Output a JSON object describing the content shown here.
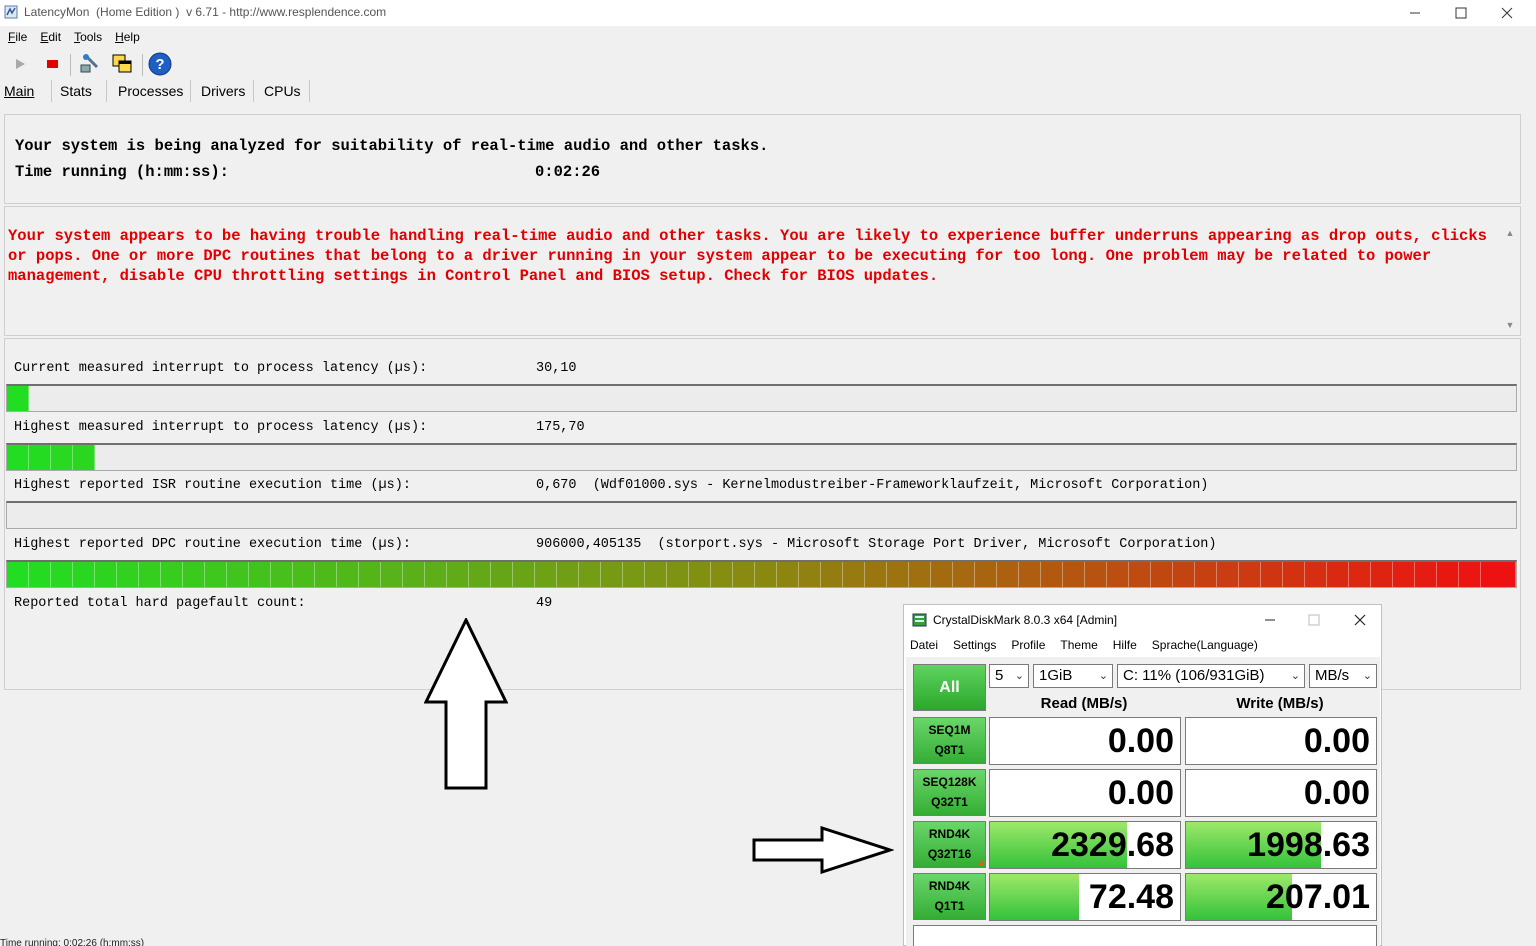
{
  "latencymon": {
    "title": "LatencyMon  (Home Edition )  v 6.71 - http://www.resplendence.com",
    "menu": [
      "File",
      "Edit",
      "Tools",
      "Help"
    ],
    "tabs": [
      "Main",
      "Stats",
      "Processes",
      "Drivers",
      "CPUs"
    ],
    "status_line1": "Your system is being analyzed for suitability of real-time audio and other tasks.",
    "status_line2_label": "Time running (h:mm:ss):",
    "status_line2_value": "0:02:26",
    "warning": "Your system appears to be having trouble handling real-time audio and other tasks. You are likely to experience buffer underruns appearing as drop outs, clicks or pops. One or more DPC routines that belong to a driver running in your system appear to be executing for too long. One problem may be related to power management, disable CPU throttling settings in Control Panel and BIOS setup. Check for BIOS updates.",
    "metrics": [
      {
        "label": "Current measured interrupt to process latency (µs):",
        "value": "30,10",
        "bar_fraction": 0.013
      },
      {
        "label": "Highest measured interrupt to process latency (µs):",
        "value": "175,70",
        "bar_fraction": 0.055
      },
      {
        "label": "Highest reported ISR routine execution time (µs):",
        "value": "0,670  (Wdf01000.sys - Kernelmodustreiber-Frameworklaufzeit, Microsoft Corporation)",
        "bar_fraction": 0.0
      },
      {
        "label": "Highest reported DPC routine execution time (µs):",
        "value": "906000,405135  (storport.sys - Microsoft Storage Port Driver, Microsoft Corporation)",
        "bar_fraction": 1.0
      },
      {
        "label": "Reported total hard pagefault count:",
        "value": "49"
      }
    ],
    "status_bar": "Time running: 0:02:26  (h:mm:ss)"
  },
  "crystaldiskmark": {
    "title": "CrystalDiskMark 8.0.3 x64 [Admin]",
    "menu": [
      "Datei",
      "Settings",
      "Profile",
      "Theme",
      "Hilfe",
      "Sprache(Language)"
    ],
    "all_label": "All",
    "count": "5",
    "size": "1GiB",
    "drive": "C: 11% (106/931GiB)",
    "unit": "MB/s",
    "read_header": "Read (MB/s)",
    "write_header": "Write (MB/s)",
    "tests": [
      {
        "line1": "SEQ1M",
        "line2": "Q8T1",
        "read": "0.00",
        "write": "0.00",
        "read_fill": 0.0,
        "write_fill": 0.0
      },
      {
        "line1": "SEQ128K",
        "line2": "Q32T1",
        "read": "0.00",
        "write": "0.00",
        "read_fill": 0.0,
        "write_fill": 0.0
      },
      {
        "line1": "RND4K",
        "line2": "Q32T16",
        "read": "2329.68",
        "write": "1998.63",
        "read_fill": 0.72,
        "write_fill": 0.71
      },
      {
        "line1": "RND4K",
        "line2": "Q1T1",
        "read": "72.48",
        "write": "207.01",
        "read_fill": 0.47,
        "write_fill": 0.56
      }
    ]
  },
  "colors": {
    "warning_red": "#e00000",
    "bar_green": "#22dd22",
    "bar_red": "#ee1111"
  }
}
